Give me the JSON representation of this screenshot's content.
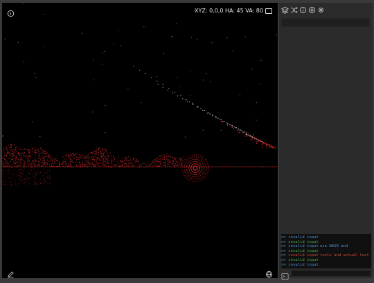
{
  "viewport": {
    "coords_readout": "XYZ: 0,0,0 HA: 45 VA: 80",
    "info_icon": "info-icon",
    "edit_icon": "pencil-icon",
    "globe_icon": "globe-icon"
  },
  "sidebar": {
    "toolbar_icons": [
      "layers-icon",
      "shuffle-icon",
      "info-icon",
      "settings-icon",
      "gear-icon"
    ],
    "search_value": ""
  },
  "console": {
    "lines": [
      {
        "prompt": ">>",
        "text": "invalid input",
        "tone": "blue",
        "tail": ""
      },
      {
        "prompt": ">>",
        "text": "invalid input",
        "tone": "green",
        "tail": ""
      },
      {
        "prompt": ">>",
        "text": "invalid input",
        "tone": "blue",
        "tail": "use WASD and"
      },
      {
        "prompt": ">>",
        "text": "invalid input",
        "tone": "green",
        "tail": ""
      },
      {
        "prompt": ">>",
        "text": "invalid input",
        "tone": "red",
        "tail": "tools and actual fact"
      },
      {
        "prompt": ">>",
        "text": "invalid input",
        "tone": "green",
        "tail": ""
      },
      {
        "prompt": ">>",
        "text": "invalid input",
        "tone": "blue",
        "tail": ""
      }
    ],
    "input_value": ""
  },
  "colors": {
    "viewport_bg": "#000000",
    "point_red": "#e02a2a",
    "panel_bg": "#2b2b2b"
  }
}
